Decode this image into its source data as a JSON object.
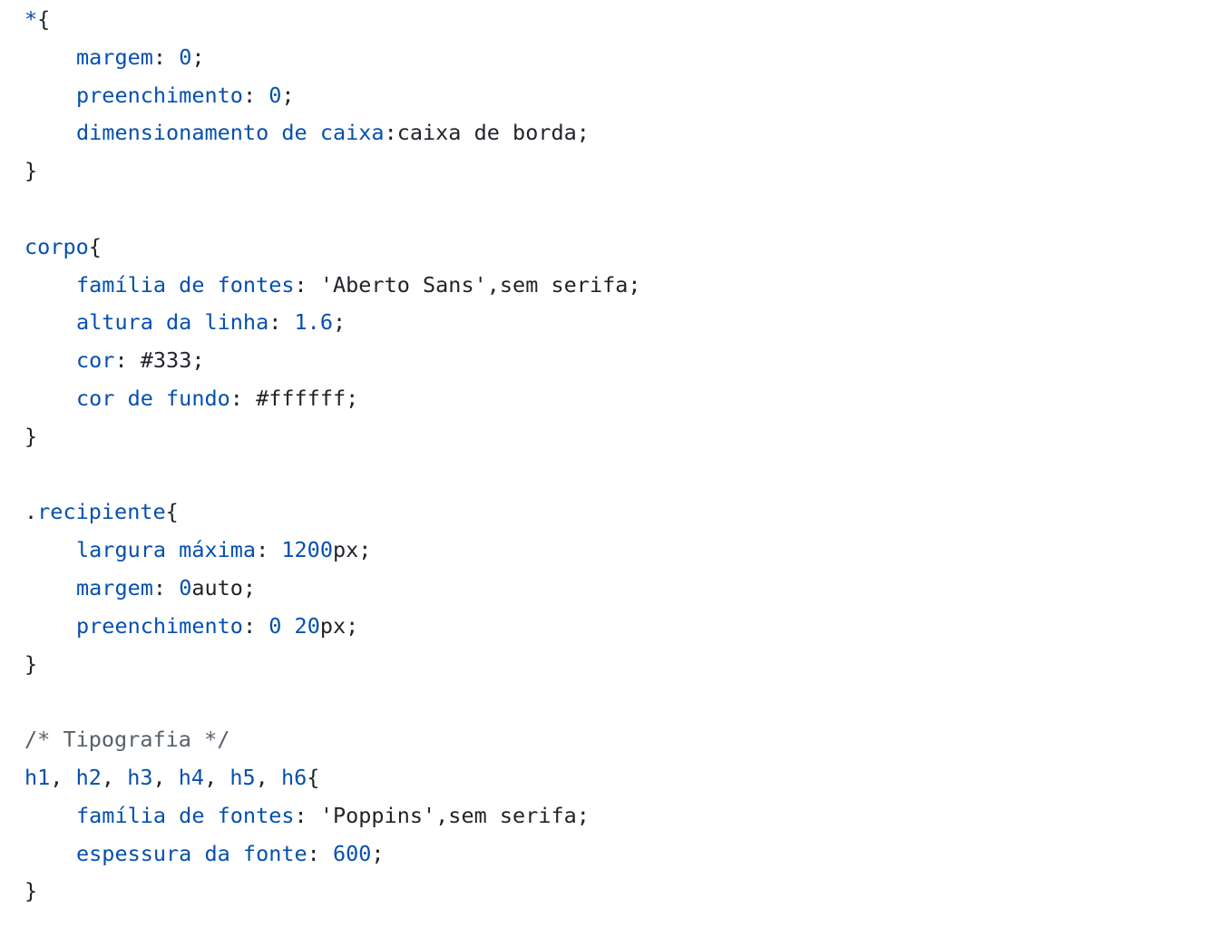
{
  "colors": {
    "keyword": "#0550ae",
    "text": "#1f2328",
    "comment": "#57606a",
    "background": "#ffffff"
  },
  "code": {
    "lines": [
      {
        "indent": 0,
        "tokens": [
          {
            "t": "*",
            "c": "keyword"
          },
          {
            "t": "{",
            "c": "text"
          }
        ]
      },
      {
        "indent": 1,
        "tokens": [
          {
            "t": "margem",
            "c": "keyword"
          },
          {
            "t": ": ",
            "c": "text"
          },
          {
            "t": "0",
            "c": "keyword"
          },
          {
            "t": ";",
            "c": "text"
          }
        ]
      },
      {
        "indent": 1,
        "tokens": [
          {
            "t": "preenchimento",
            "c": "keyword"
          },
          {
            "t": ": ",
            "c": "text"
          },
          {
            "t": "0",
            "c": "keyword"
          },
          {
            "t": ";",
            "c": "text"
          }
        ]
      },
      {
        "indent": 1,
        "tokens": [
          {
            "t": "dimensionamento de caixa",
            "c": "keyword"
          },
          {
            "t": ":caixa de borda;",
            "c": "text"
          }
        ]
      },
      {
        "indent": 0,
        "tokens": [
          {
            "t": "}",
            "c": "text"
          }
        ]
      },
      {
        "indent": 0,
        "tokens": []
      },
      {
        "indent": 0,
        "tokens": [
          {
            "t": "corpo",
            "c": "keyword"
          },
          {
            "t": "{",
            "c": "text"
          }
        ]
      },
      {
        "indent": 1,
        "tokens": [
          {
            "t": "família de fontes",
            "c": "keyword"
          },
          {
            "t": ": 'Aberto Sans',sem serifa;",
            "c": "text"
          }
        ]
      },
      {
        "indent": 1,
        "tokens": [
          {
            "t": "altura da linha",
            "c": "keyword"
          },
          {
            "t": ": ",
            "c": "text"
          },
          {
            "t": "1.6",
            "c": "keyword"
          },
          {
            "t": ";",
            "c": "text"
          }
        ]
      },
      {
        "indent": 1,
        "tokens": [
          {
            "t": "cor",
            "c": "keyword"
          },
          {
            "t": ": #333;",
            "c": "text"
          }
        ]
      },
      {
        "indent": 1,
        "tokens": [
          {
            "t": "cor de fundo",
            "c": "keyword"
          },
          {
            "t": ": #ffffff;",
            "c": "text"
          }
        ]
      },
      {
        "indent": 0,
        "tokens": [
          {
            "t": "}",
            "c": "text"
          }
        ]
      },
      {
        "indent": 0,
        "tokens": []
      },
      {
        "indent": 0,
        "tokens": [
          {
            "t": ".",
            "c": "text"
          },
          {
            "t": "recipiente",
            "c": "keyword"
          },
          {
            "t": "{",
            "c": "text"
          }
        ]
      },
      {
        "indent": 1,
        "tokens": [
          {
            "t": "largura máxima",
            "c": "keyword"
          },
          {
            "t": ": ",
            "c": "text"
          },
          {
            "t": "1200",
            "c": "keyword"
          },
          {
            "t": "px;",
            "c": "text"
          }
        ]
      },
      {
        "indent": 1,
        "tokens": [
          {
            "t": "margem",
            "c": "keyword"
          },
          {
            "t": ": ",
            "c": "text"
          },
          {
            "t": "0",
            "c": "keyword"
          },
          {
            "t": "auto;",
            "c": "text"
          }
        ]
      },
      {
        "indent": 1,
        "tokens": [
          {
            "t": "preenchimento",
            "c": "keyword"
          },
          {
            "t": ": ",
            "c": "text"
          },
          {
            "t": "0",
            "c": "keyword"
          },
          {
            "t": " ",
            "c": "text"
          },
          {
            "t": "20",
            "c": "keyword"
          },
          {
            "t": "px;",
            "c": "text"
          }
        ]
      },
      {
        "indent": 0,
        "tokens": [
          {
            "t": "}",
            "c": "text"
          }
        ]
      },
      {
        "indent": 0,
        "tokens": []
      },
      {
        "indent": 0,
        "tokens": [
          {
            "t": "/* Tipografia */",
            "c": "comment"
          }
        ]
      },
      {
        "indent": 0,
        "tokens": [
          {
            "t": "h1",
            "c": "keyword"
          },
          {
            "t": ", ",
            "c": "text"
          },
          {
            "t": "h2",
            "c": "keyword"
          },
          {
            "t": ", ",
            "c": "text"
          },
          {
            "t": "h3",
            "c": "keyword"
          },
          {
            "t": ", ",
            "c": "text"
          },
          {
            "t": "h4",
            "c": "keyword"
          },
          {
            "t": ", ",
            "c": "text"
          },
          {
            "t": "h5",
            "c": "keyword"
          },
          {
            "t": ", ",
            "c": "text"
          },
          {
            "t": "h6",
            "c": "keyword"
          },
          {
            "t": "{",
            "c": "text"
          }
        ]
      },
      {
        "indent": 1,
        "tokens": [
          {
            "t": "família de fontes",
            "c": "keyword"
          },
          {
            "t": ": 'Poppins',sem serifa;",
            "c": "text"
          }
        ]
      },
      {
        "indent": 1,
        "tokens": [
          {
            "t": "espessura da fonte",
            "c": "keyword"
          },
          {
            "t": ": ",
            "c": "text"
          },
          {
            "t": "600",
            "c": "keyword"
          },
          {
            "t": ";",
            "c": "text"
          }
        ]
      },
      {
        "indent": 0,
        "tokens": [
          {
            "t": "}",
            "c": "text"
          }
        ]
      }
    ]
  }
}
